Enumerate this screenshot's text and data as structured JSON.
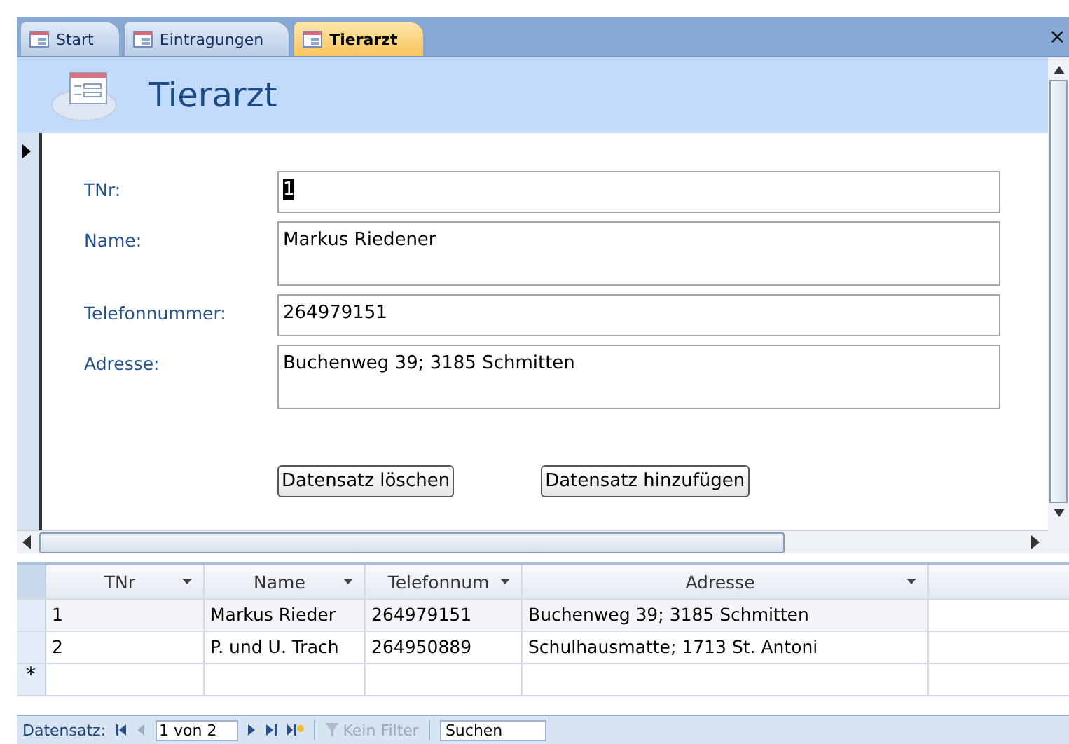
{
  "tabs": [
    {
      "label": "Start",
      "selected": false
    },
    {
      "label": "Eintragungen",
      "selected": false
    },
    {
      "label": "Tierarzt",
      "selected": true
    }
  ],
  "close": "×",
  "form": {
    "title": "Tierarzt",
    "fields": [
      {
        "label": "TNr:",
        "value": "1",
        "tall": false,
        "focused": true
      },
      {
        "label": "Name:",
        "value": "Markus Riedener",
        "tall": true,
        "focused": false
      },
      {
        "label": "Telefonnummer:",
        "value": "264979151",
        "tall": false,
        "focused": false
      },
      {
        "label": "Adresse:",
        "value": "Buchenweg 39; 3185 Schmitten",
        "tall": true,
        "focused": false
      }
    ],
    "buttons": [
      "Datensatz löschen",
      "Datensatz hinzufügen"
    ]
  },
  "table": {
    "columns": [
      "TNr",
      "Name",
      "Telefonnum",
      "Adresse"
    ],
    "rows": [
      {
        "cells": [
          "1",
          "Markus Rieder",
          "264979151",
          "Buchenweg 39; 3185 Schmitten"
        ],
        "selected": true
      },
      {
        "cells": [
          "2",
          "P. und U. Trach",
          "264950889",
          "Schulhausmatte; 1713 St. Antoni"
        ],
        "selected": false
      }
    ],
    "new_row_marker": "*"
  },
  "navigation": {
    "label": "Datensatz:",
    "position": "1 von 2",
    "filter": "Kein Filter",
    "filter_disabled": true,
    "search": "Suchen"
  }
}
